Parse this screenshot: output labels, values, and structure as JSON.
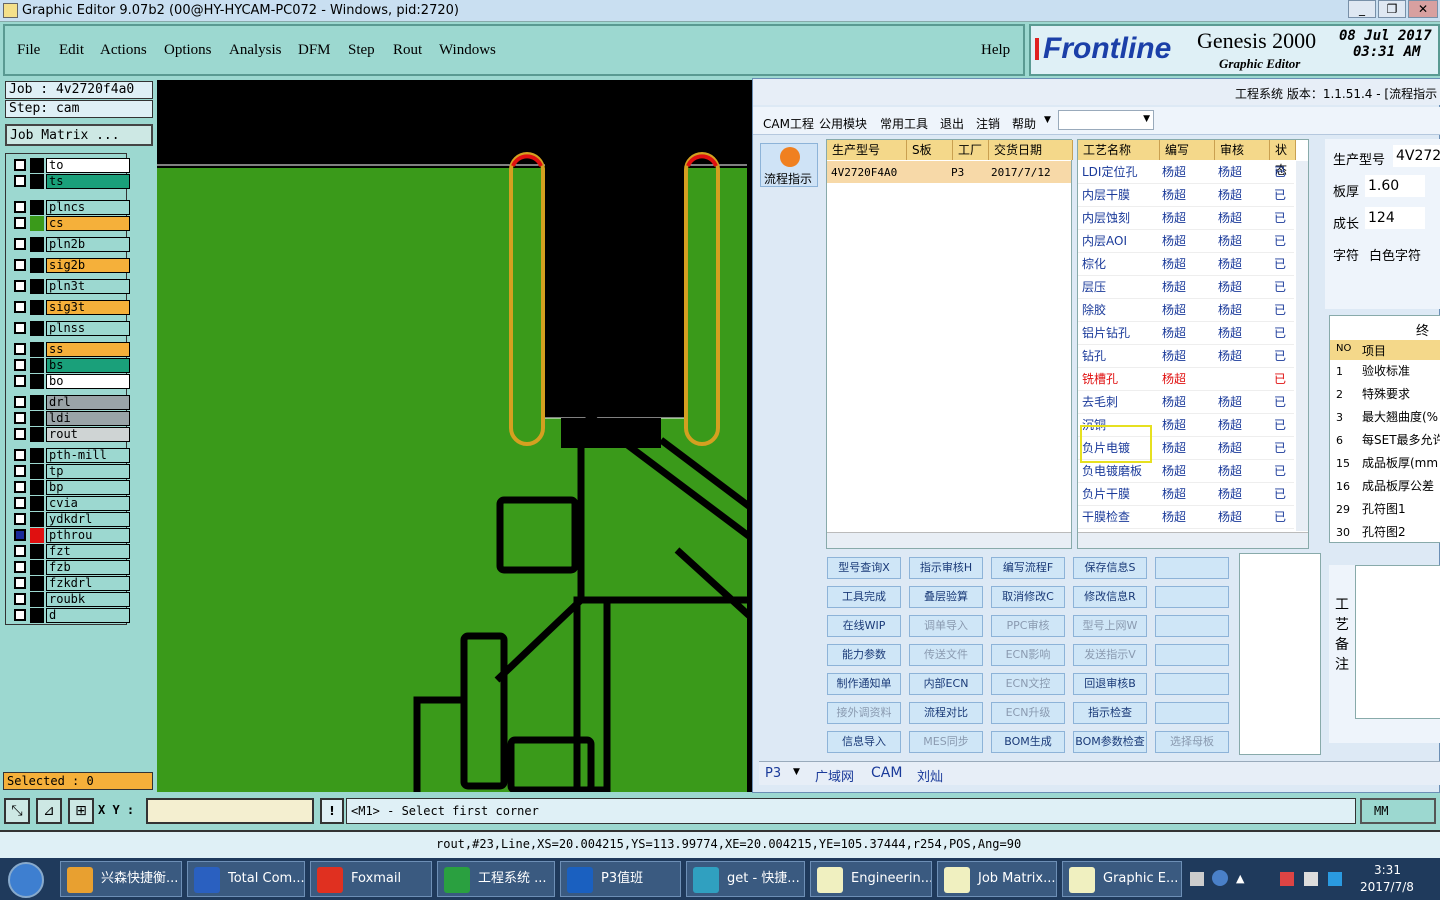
{
  "window": {
    "title": "Graphic Editor 9.07b2 (00@HY-HYCAM-PC072 - Windows, pid:2720)"
  },
  "menu": {
    "items": [
      "File",
      "Edit",
      "Actions",
      "Options",
      "Analysis",
      "DFM",
      "Step",
      "Rout",
      "Windows"
    ],
    "help": "Help"
  },
  "logo": {
    "brand": "Frontline",
    "product": "Genesis 2000",
    "subtitle": "Graphic Editor",
    "date": "08 Jul 2017",
    "time": "03:31 AM"
  },
  "job": {
    "job_label": "Job : 4v2720f4a0",
    "step_label": "Step: cam",
    "matrix_button": "Job Matrix ..."
  },
  "layers": [
    {
      "name": "to",
      "color": "#ffffff"
    },
    {
      "name": "ts",
      "color": "#1aa07a"
    },
    {
      "name": "plncs",
      "color": "#9cd8d0"
    },
    {
      "name": "cs",
      "color": "#f5b03a"
    },
    {
      "name": "pln2b",
      "color": "#9cd8d0"
    },
    {
      "name": "sig2b",
      "color": "#f5b03a"
    },
    {
      "name": "pln3t",
      "color": "#9cd8d0"
    },
    {
      "name": "sig3t",
      "color": "#f5b03a"
    },
    {
      "name": "plnss",
      "color": "#9cd8d0"
    },
    {
      "name": "ss",
      "color": "#f5b03a"
    },
    {
      "name": "bs",
      "color": "#1aa07a"
    },
    {
      "name": "bo",
      "color": "#ffffff"
    },
    {
      "name": "drl",
      "color": "#9aa4a8"
    },
    {
      "name": "ldi",
      "color": "#9aa4a8"
    },
    {
      "name": "rout",
      "color": "#cfd4d4"
    },
    {
      "name": "pth-mill",
      "color": "#9cd8d0"
    },
    {
      "name": "tp",
      "color": "#9cd8d0"
    },
    {
      "name": "bp",
      "color": "#9cd8d0"
    },
    {
      "name": "cvia",
      "color": "#9cd8d0"
    },
    {
      "name": "ydkdrl",
      "color": "#9cd8d0"
    },
    {
      "name": "pthrou",
      "color": "#9cd8d0"
    },
    {
      "name": "fzt",
      "color": "#9cd8d0"
    },
    {
      "name": "fzb",
      "color": "#9cd8d0"
    },
    {
      "name": "fzkdrl",
      "color": "#9cd8d0"
    },
    {
      "name": "roubk",
      "color": "#9cd8d0"
    },
    {
      "name": "d",
      "color": "#9cd8d0"
    }
  ],
  "selected": "Selected : 0",
  "erp": {
    "header_right": "工程系统   版本：1.1.51.4 - [流程指示",
    "toolbar": [
      "CAM工程",
      "公用模块",
      "常用工具",
      "退出",
      "注销",
      "帮助"
    ],
    "flow_button": "流程指示",
    "left_grid": {
      "headers": [
        "生产型号",
        "S板",
        "工厂",
        "交货日期"
      ],
      "row": [
        "4V2720F4A0",
        "",
        "P3",
        "2017/7/12"
      ]
    },
    "process_grid": {
      "headers": [
        "工艺名称",
        "编写",
        "审核",
        "状态"
      ],
      "rows": [
        [
          "LDI定位孔",
          "杨超",
          "杨超",
          "已审"
        ],
        [
          "内层干膜",
          "杨超",
          "杨超",
          "已审"
        ],
        [
          "内层蚀刻",
          "杨超",
          "杨超",
          "已审"
        ],
        [
          "内层AOI",
          "杨超",
          "杨超",
          "已审"
        ],
        [
          "棕化",
          "杨超",
          "杨超",
          "已审"
        ],
        [
          "层压",
          "杨超",
          "杨超",
          "已审"
        ],
        [
          "除胶",
          "杨超",
          "杨超",
          "已审"
        ],
        [
          "铝片钻孔",
          "杨超",
          "杨超",
          "已审"
        ],
        [
          "钻孔",
          "杨超",
          "杨超",
          "已审"
        ],
        [
          "铣槽孔",
          "杨超",
          "",
          "已回"
        ],
        [
          "去毛刺",
          "杨超",
          "杨超",
          "已审"
        ],
        [
          "沉铜",
          "杨超",
          "杨超",
          "已审"
        ],
        [
          "负片电镀",
          "杨超",
          "杨超",
          "已审"
        ],
        [
          "负电镀磨板",
          "杨超",
          "杨超",
          "已审"
        ],
        [
          "负片干膜",
          "杨超",
          "杨超",
          "已审"
        ],
        [
          "干膜检查",
          "杨超",
          "杨超",
          "已审"
        ]
      ]
    },
    "info": {
      "model_label": "生产型号",
      "model_value": "4V272",
      "thickness_label": "板厚",
      "thickness_value": "1.60",
      "length_label": "成长",
      "length_value": "124",
      "char_label": "字符",
      "char_value": "白色字符"
    },
    "check_grid": {
      "title": "终检",
      "headers": [
        "NO",
        "项目"
      ],
      "rows": [
        [
          "1",
          "验收标准"
        ],
        [
          "2",
          "特殊要求"
        ],
        [
          "3",
          "最大翘曲度(%"
        ],
        [
          "6",
          "每SET最多允许"
        ],
        [
          "15",
          "成品板厚(mm"
        ],
        [
          "16",
          "成品板厚公差"
        ],
        [
          "29",
          "孔符图1"
        ],
        [
          "30",
          "孔符图2"
        ]
      ]
    },
    "buttons": [
      [
        "型号查询X",
        "指示审核H",
        "编写流程F",
        "保存信息S",
        ""
      ],
      [
        "工具完成",
        "叠层验算",
        "取消修改C",
        "修改信息R",
        ""
      ],
      [
        "在线WIP",
        "调单导入",
        "PPC审核",
        "型号上网W",
        ""
      ],
      [
        "能力参数",
        "传送文件",
        "ECN影响",
        "发送指示V",
        ""
      ],
      [
        "制作通知单",
        "内部ECN",
        "ECN文控",
        "回退审核B",
        ""
      ],
      [
        "接外调资料",
        "流程对比",
        "ECN升级",
        "指示检查",
        ""
      ],
      [
        "信息导入",
        "MES同步",
        "BOM生成",
        "BOM参数检查",
        "选择母板"
      ]
    ],
    "buttons_disabled": [
      "调单导入",
      "PPC审核",
      "型号上网W",
      "传送文件",
      "ECN影响",
      "发送指示V",
      "ECN文控",
      "接外调资料",
      "ECN升级",
      "MES同步",
      "选择母板"
    ],
    "remark_label": "工艺备注",
    "footer": [
      "P3",
      "广域网",
      "CAM",
      "刘灿"
    ]
  },
  "status": {
    "xy_label": "X Y :",
    "xy_value": "",
    "prompt": "<M1> - Select first corner",
    "units": "MM"
  },
  "infoline": "rout,#23,Line,XS=20.004215,YS=113.99774,XE=20.004215,YE=105.37444,r254,POS,Ang=90",
  "taskbar": {
    "items": [
      "兴森快捷衡...",
      "Total Com...",
      "Foxmail",
      "工程系统 ...",
      "P3值班",
      "get - 快捷...",
      "Engineerin...",
      "Job Matrix...",
      "Graphic E..."
    ],
    "clock_time": "3:31",
    "clock_date": "2017/7/8"
  }
}
